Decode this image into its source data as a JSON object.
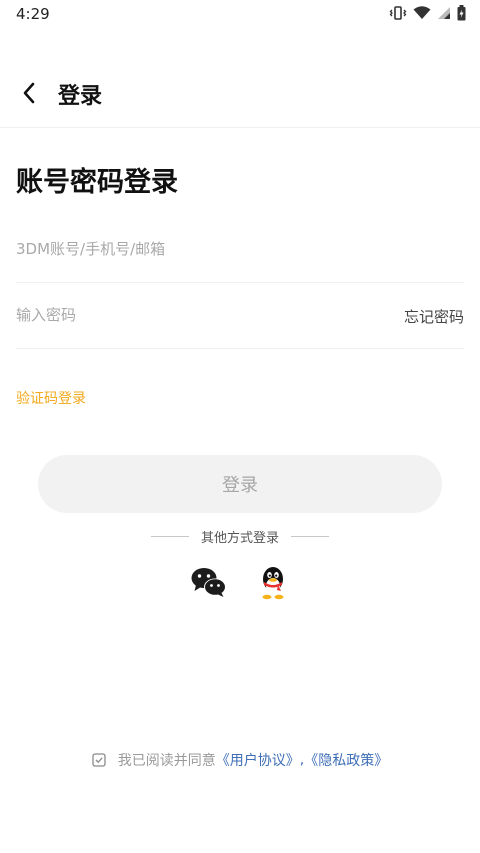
{
  "status_bar": {
    "time": "4:29"
  },
  "header": {
    "title": "登录"
  },
  "form": {
    "title": "账号密码登录",
    "account_placeholder": "3DM账号/手机号/邮箱",
    "password_placeholder": "输入密码",
    "forgot_password": "忘记密码",
    "sms_login": "验证码登录",
    "login_button": "登录"
  },
  "other_login": {
    "label": "其他方式登录",
    "providers": [
      "wechat-icon",
      "qq-icon"
    ]
  },
  "agreement": {
    "text": "我已阅读并同意",
    "user_agreement": "《用户协议》",
    "separator": ",",
    "privacy_policy": "《隐私政策》"
  },
  "colors": {
    "accent": "#f3a91c",
    "link": "#3f6fb6",
    "button_bg": "#f2f2f2",
    "button_text": "#a6a6a6"
  }
}
